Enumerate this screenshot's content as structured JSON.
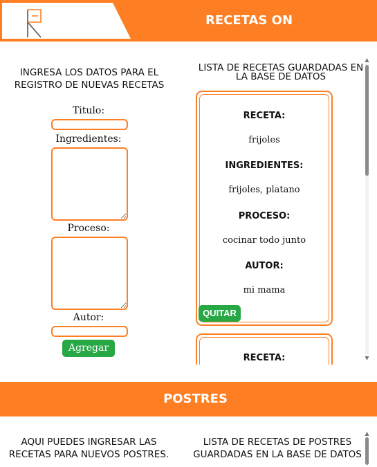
{
  "header": {
    "title": "RECETAS ON"
  },
  "colors": {
    "accent": "#fd7e23",
    "button_green": "#28a745"
  },
  "form": {
    "heading": "INGRESA LOS DATOS PARA EL REGISTRO DE NUEVAS RECETAS",
    "titulo_label": "Titulo:",
    "ingredientes_label": "Ingredientes:",
    "proceso_label": "Proceso:",
    "autor_label": "Autor:",
    "titulo_value": "",
    "ingredientes_value": "",
    "proceso_value": "",
    "autor_value": "",
    "submit_label": "Agregar"
  },
  "list": {
    "heading": "LISTA DE RECETAS GUARDADAS EN LA BASE DE DATOS",
    "cards": [
      {
        "receta_label": "RECETA:",
        "receta": "frijoles",
        "ingredientes_label": "INGREDIENTES:",
        "ingredientes": "frijoles, platano",
        "proceso_label": "PROCESO:",
        "proceso": "cocinar todo junto",
        "autor_label": "AUTOR:",
        "autor": "mi mama",
        "quitar_label": "QUITAR"
      },
      {
        "receta_label": "RECETA:"
      }
    ]
  },
  "postres": {
    "title": "POSTRES",
    "form_heading": "AQUI PUEDES INGRESAR LAS RECETAS PARA NUEVOS POSTRES.",
    "list_heading": "LISTA DE RECETAS DE POSTRES GUARDADAS EN LA BASE DE DATOS"
  }
}
